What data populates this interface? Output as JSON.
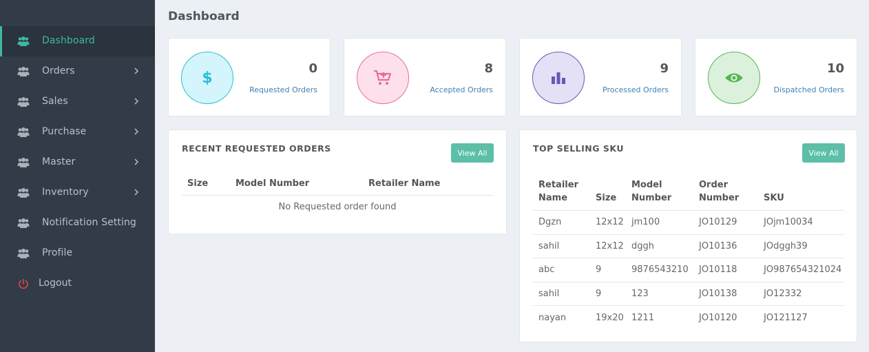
{
  "sidebar": {
    "items": [
      {
        "label": "Dashboard",
        "icon": "users-icon",
        "active": true,
        "has_chevron": false
      },
      {
        "label": "Orders",
        "icon": "users-icon",
        "has_chevron": true
      },
      {
        "label": "Sales",
        "icon": "users-icon",
        "has_chevron": true
      },
      {
        "label": "Purchase",
        "icon": "users-icon",
        "has_chevron": true
      },
      {
        "label": "Master",
        "icon": "users-icon",
        "has_chevron": true
      },
      {
        "label": "Inventory",
        "icon": "users-icon",
        "has_chevron": true
      },
      {
        "label": "Notification Setting",
        "icon": "users-icon",
        "has_chevron": false
      },
      {
        "label": "Profile",
        "icon": "users-icon",
        "has_chevron": false
      }
    ],
    "logout_label": "Logout"
  },
  "page": {
    "title": "Dashboard"
  },
  "stats": [
    {
      "value": "0",
      "label": "Requested Orders",
      "icon": "dollar-icon",
      "color": "#2bbfd6"
    },
    {
      "value": "8",
      "label": "Accepted Orders",
      "icon": "cart-plus-icon",
      "color": "#e86b9c"
    },
    {
      "value": "9",
      "label": "Processed Orders",
      "icon": "bar-chart-icon",
      "color": "#6b57b5"
    },
    {
      "value": "10",
      "label": "Dispatched Orders",
      "icon": "eye-icon",
      "color": "#56b557"
    }
  ],
  "recent_orders": {
    "title": "RECENT REQUESTED ORDERS",
    "view_all_label": "View All",
    "columns": [
      "Size",
      "Model Number",
      "Retailer Name"
    ],
    "empty_message": "No Requested order found"
  },
  "top_sku": {
    "title": "TOP SELLING SKU",
    "view_all_label": "View All",
    "columns": [
      "Retailer Name",
      "Size",
      "Model Number",
      "Order Number",
      "SKU"
    ],
    "rows": [
      [
        "Dgzn",
        "12x12",
        "jm100",
        "JO10129",
        "JOjm10034"
      ],
      [
        "sahil",
        "12x12",
        "dggh",
        "JO10136",
        "JOdggh39"
      ],
      [
        "abc",
        "9",
        "9876543210",
        "JO10118",
        "JO987654321024"
      ],
      [
        "sahil",
        "9",
        "123",
        "JO10138",
        "JO12332"
      ],
      [
        "nayan",
        "19x20",
        "1211",
        "JO10120",
        "JO121127"
      ]
    ]
  },
  "colors": {
    "sidebar_bg": "#323c48",
    "accent": "#3fb8a1",
    "button": "#5cbfa8",
    "link": "#3e7fb3",
    "logout": "#e0484b"
  }
}
